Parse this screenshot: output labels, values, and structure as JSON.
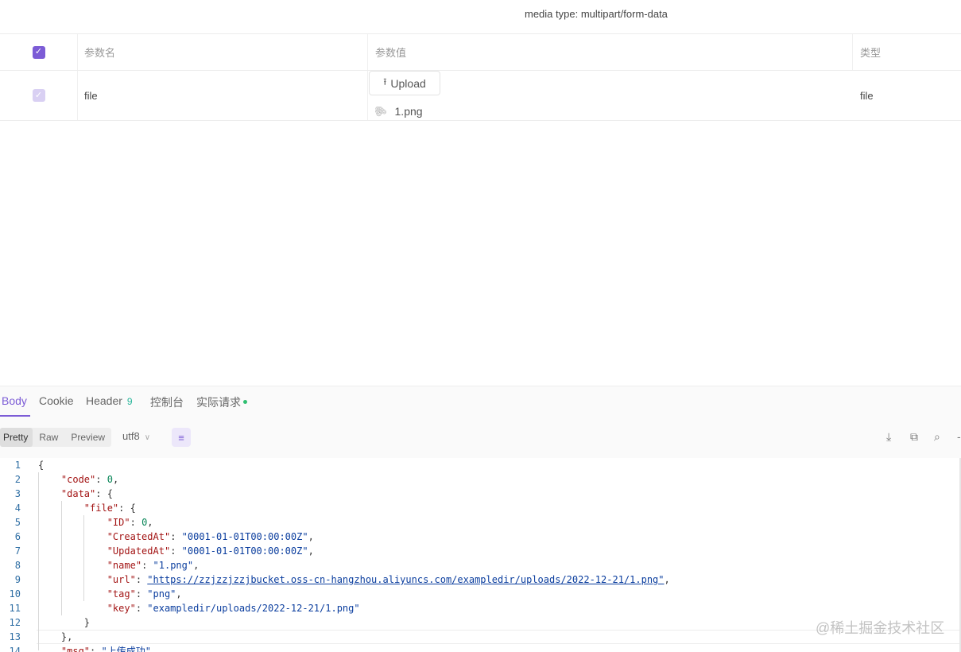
{
  "media_type_label": "media type: multipart/form-data",
  "params_table": {
    "headers": {
      "name": "参数名",
      "value": "参数值",
      "type": "类型"
    },
    "row": {
      "name": "file",
      "upload_label": "Upload",
      "file_name": "1.png",
      "type": "file"
    }
  },
  "response": {
    "tabs": [
      {
        "label": "Body"
      },
      {
        "label": "Cookie"
      },
      {
        "label": "Header",
        "badge": "9"
      },
      {
        "label": "控制台"
      },
      {
        "label": "实际请求"
      }
    ],
    "view_modes": [
      "Pretty",
      "Raw",
      "Preview"
    ],
    "encoding": "utf8"
  },
  "code_lines": [
    {
      "n": "1",
      "t": "{"
    },
    {
      "n": "2",
      "t": "    \"code\": 0,"
    },
    {
      "n": "3",
      "t": "    \"data\": {"
    },
    {
      "n": "4",
      "t": "        \"file\": {"
    },
    {
      "n": "5",
      "t": "            \"ID\": 0,"
    },
    {
      "n": "6",
      "t": "            \"CreatedAt\": \"0001-01-01T00:00:00Z\","
    },
    {
      "n": "7",
      "t": "            \"UpdatedAt\": \"0001-01-01T00:00:00Z\","
    },
    {
      "n": "8",
      "t": "            \"name\": \"1.png\","
    },
    {
      "n": "9",
      "t": "            \"url\": \"https://zzjzzjzzjbucket.oss-cn-hangzhou.aliyuncs.com/exampledir/uploads/2022-12-21/1.png\","
    },
    {
      "n": "10",
      "t": "            \"tag\": \"png\","
    },
    {
      "n": "11",
      "t": "            \"key\": \"exampledir/uploads/2022-12-21/1.png\""
    },
    {
      "n": "12",
      "t": "        }"
    },
    {
      "n": "13",
      "t": "    },"
    },
    {
      "n": "14",
      "t": "    \"msg\": \"上传成功\""
    }
  ],
  "watermark": "@稀土掘金技术社区",
  "colors": {
    "accent": "#7c5cd6",
    "badge": "#27b59a",
    "dot": "#2fbf71"
  }
}
